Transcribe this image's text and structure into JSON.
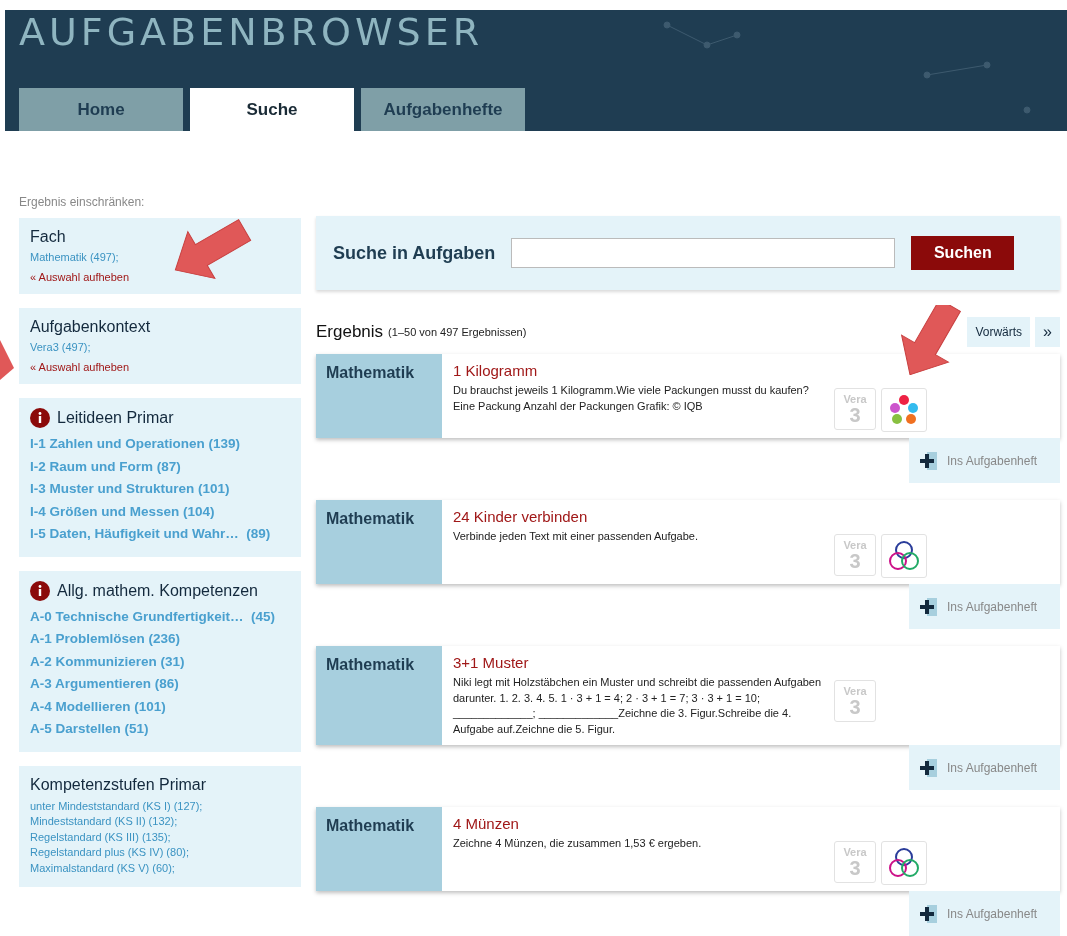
{
  "header": {
    "title": "AUFGABENBROWSER"
  },
  "tabs": [
    {
      "label": "Home",
      "selected": false
    },
    {
      "label": "Suche",
      "selected": true
    },
    {
      "label": "Aufgabenhefte",
      "selected": false
    }
  ],
  "sidebar": {
    "heading": "Ergebnis einschränken:",
    "panels": [
      {
        "kind": "selected",
        "title": "Fach",
        "value": "Mathematik (497);",
        "clear": "« Auswahl aufheben"
      },
      {
        "kind": "selected",
        "title": "Aufgabenkontext",
        "value": "Vera3 (497);",
        "clear": "« Auswahl aufheben"
      },
      {
        "kind": "info",
        "title": "Leitideen Primar",
        "items": [
          "I-1 Zahlen und Operationen (139)",
          "I-2 Raum und Form (87)",
          "I-3 Muster und Strukturen (101)",
          "I-4 Größen und Messen (104)",
          "I-5 Daten, Häufigkeit und Wahr…  (89)"
        ]
      },
      {
        "kind": "info",
        "title": "Allg. mathem. Kompetenzen",
        "items": [
          "A-0 Technische Grundfertigkeit…  (45)",
          "A-1 Problemlösen (236)",
          "A-2 Kommunizieren (31)",
          "A-3 Argumentieren (86)",
          "A-4 Modellieren (101)",
          "A-5 Darstellen (51)"
        ]
      },
      {
        "kind": "small",
        "title": "Kompetenzstufen Primar",
        "items": [
          "unter Mindeststandard (KS I) (127);",
          "Mindeststandard (KS II) (132);",
          "Regelstandard (KS III) (135);",
          "Regelstandard plus (KS IV) (80);",
          "Maximalstandard (KS V) (60);"
        ]
      }
    ]
  },
  "search": {
    "label": "Suche in Aufgaben",
    "button": "Suchen"
  },
  "results": {
    "title": "Ergebnis",
    "count": "(1–50 von 497 Ergebnissen)",
    "next": "Vorwärts",
    "last": "»",
    "items": [
      {
        "subject": "Mathematik",
        "title": "1 Kilogramm",
        "text": "Du brauchst jeweils 1 Kilogramm.Wie viele Packungen musst du kaufen? Eine Packung Anzahl der Packungen Grafik: © IQB",
        "badge": [
          "Vera",
          "3"
        ],
        "kind": "dots",
        "add": "Ins Aufgabenheft"
      },
      {
        "subject": "Mathematik",
        "title": "24 Kinder verbinden",
        "text": "Verbinde jeden Text mit einer passenden Aufgabe.",
        "badge": [
          "Vera",
          "3"
        ],
        "kind": "rings",
        "add": "Ins Aufgabenheft"
      },
      {
        "subject": "Mathematik",
        "title": "3+1 Muster",
        "text": "Niki legt mit Holzstäbchen ein Muster und schreibt die passenden Aufgaben darunter. 1. 2. 3. 4. 5. 1 · 3 + 1 = 4; 2 · 3 + 1 = 7; 3 · 3 + 1 = 10; _____________; _____________Zeichne die 3. Figur.Schreibe die 4. Aufgabe auf.Zeichne die 5. Figur.",
        "badge": [
          "Vera",
          "3"
        ],
        "add": "Ins Aufgabenheft"
      },
      {
        "subject": "Mathematik",
        "title": "4 Münzen",
        "text": "Zeichne 4 Münzen, die zusammen 1,53 € ergeben.",
        "badge": [
          "Vera",
          "3"
        ],
        "kind": "rings",
        "add": "Ins Aufgabenheft"
      }
    ]
  }
}
